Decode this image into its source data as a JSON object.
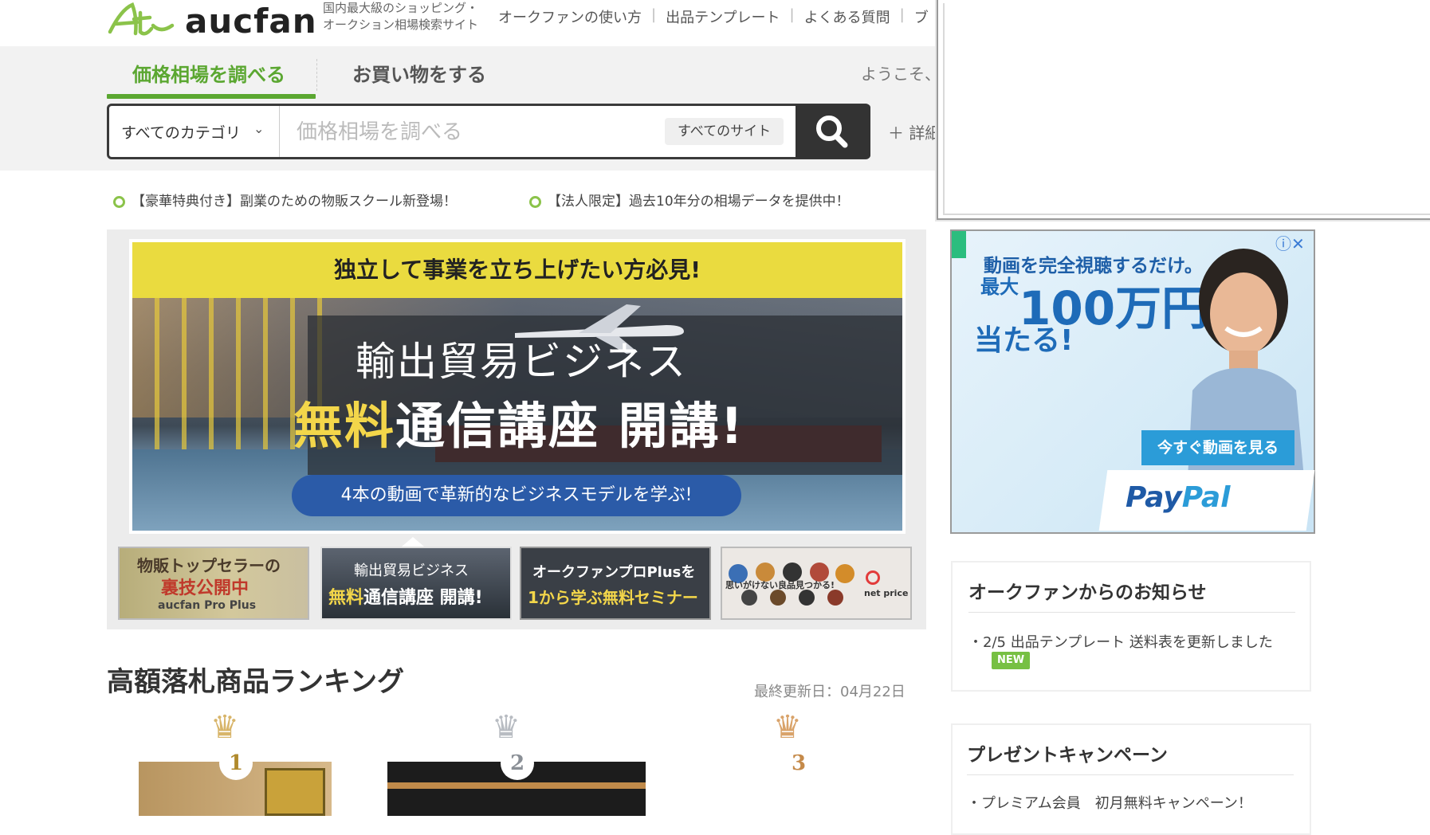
{
  "header": {
    "logo_text": "aucfan",
    "tagline_1": "国内最大級のショッピング・",
    "tagline_2": "オークション相場検索サイト",
    "nav": [
      "オークファンの使い方",
      "出品テンプレート",
      "よくある質問",
      "ブ"
    ]
  },
  "tabs": {
    "price": "価格相場を調べる",
    "shop": "お買い物をする"
  },
  "welcome": "ようこそ、",
  "search": {
    "category": "すべてのカテゴリ",
    "placeholder": "価格相場を調べる",
    "site": "すべてのサイト",
    "detail": "＋ 詳細"
  },
  "notices": [
    "【豪華特典付き】副業のための物販スクール新登場！",
    "【法人限定】過去10年分の相場データを提供中！"
  ],
  "banner": {
    "top": "独立して事業を立ち上げたい方必見!",
    "title1": "輸出貿易ビジネス",
    "title2_yellow": "無料",
    "title2_white": "通信講座 開講!",
    "pill": "4本の動画で革新的なビジネスモデルを学ぶ!"
  },
  "thumbs": {
    "t1_line1": "物販トップセラーの",
    "t1_line2": "裏技公開中",
    "t1_logo": "aucfan Pro Plus",
    "t2_line1": "輸出貿易ビジネス",
    "t2_line2_yellow": "無料",
    "t2_line2_white": "通信講座 開講!",
    "t3_line1": "オークファンプロPlusを",
    "t3_line2": "1から学ぶ",
    "t3_line2_yellow": "無料セミナー",
    "t4_text": "思いがけない良品見つかる!",
    "t4_logo": "net price"
  },
  "ranking": {
    "title": "高額落札商品ランキング",
    "updated": "最終更新日：04月22日",
    "ranks": [
      "1",
      "2",
      "3"
    ]
  },
  "ad": {
    "line1": "動画を完全視聴するだけ。",
    "line2_small": "最大",
    "line2": "100万円が",
    "line3": "当たる!",
    "cta": "今すぐ動画を見る",
    "brand_pay": "Pay",
    "brand_pal": "Pal"
  },
  "info_panel": {
    "title": "オークファンからのお知らせ",
    "item": "・2/5 出品テンプレート 送料表を更新しました",
    "badge": "NEW"
  },
  "campaign_panel": {
    "title": "プレゼントキャンペーン",
    "item": "・プレミアム会員　初月無料キャンペーン！"
  },
  "colors": {
    "accent": "#5ba731",
    "search_button": "#333333",
    "banner_yellow": "#eadb3f",
    "ad_blue": "#1e6bb8"
  }
}
